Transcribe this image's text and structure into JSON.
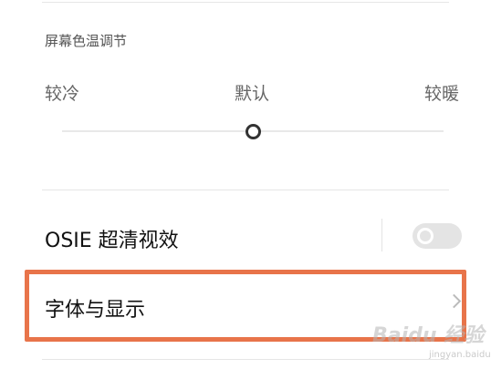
{
  "screen_temperature": {
    "title": "屏幕色温调节",
    "label_cool": "较冷",
    "label_default": "默认",
    "label_warm": "较暖",
    "slider_value": 0.5
  },
  "osie": {
    "label": "OSIE 超清视效",
    "toggle_state": "off"
  },
  "font_display": {
    "label": "字体与显示"
  },
  "watermark": {
    "text": "Baidu 经验",
    "sub": "jingyan.baidu.com"
  },
  "colors": {
    "highlight": "#e8744a"
  }
}
